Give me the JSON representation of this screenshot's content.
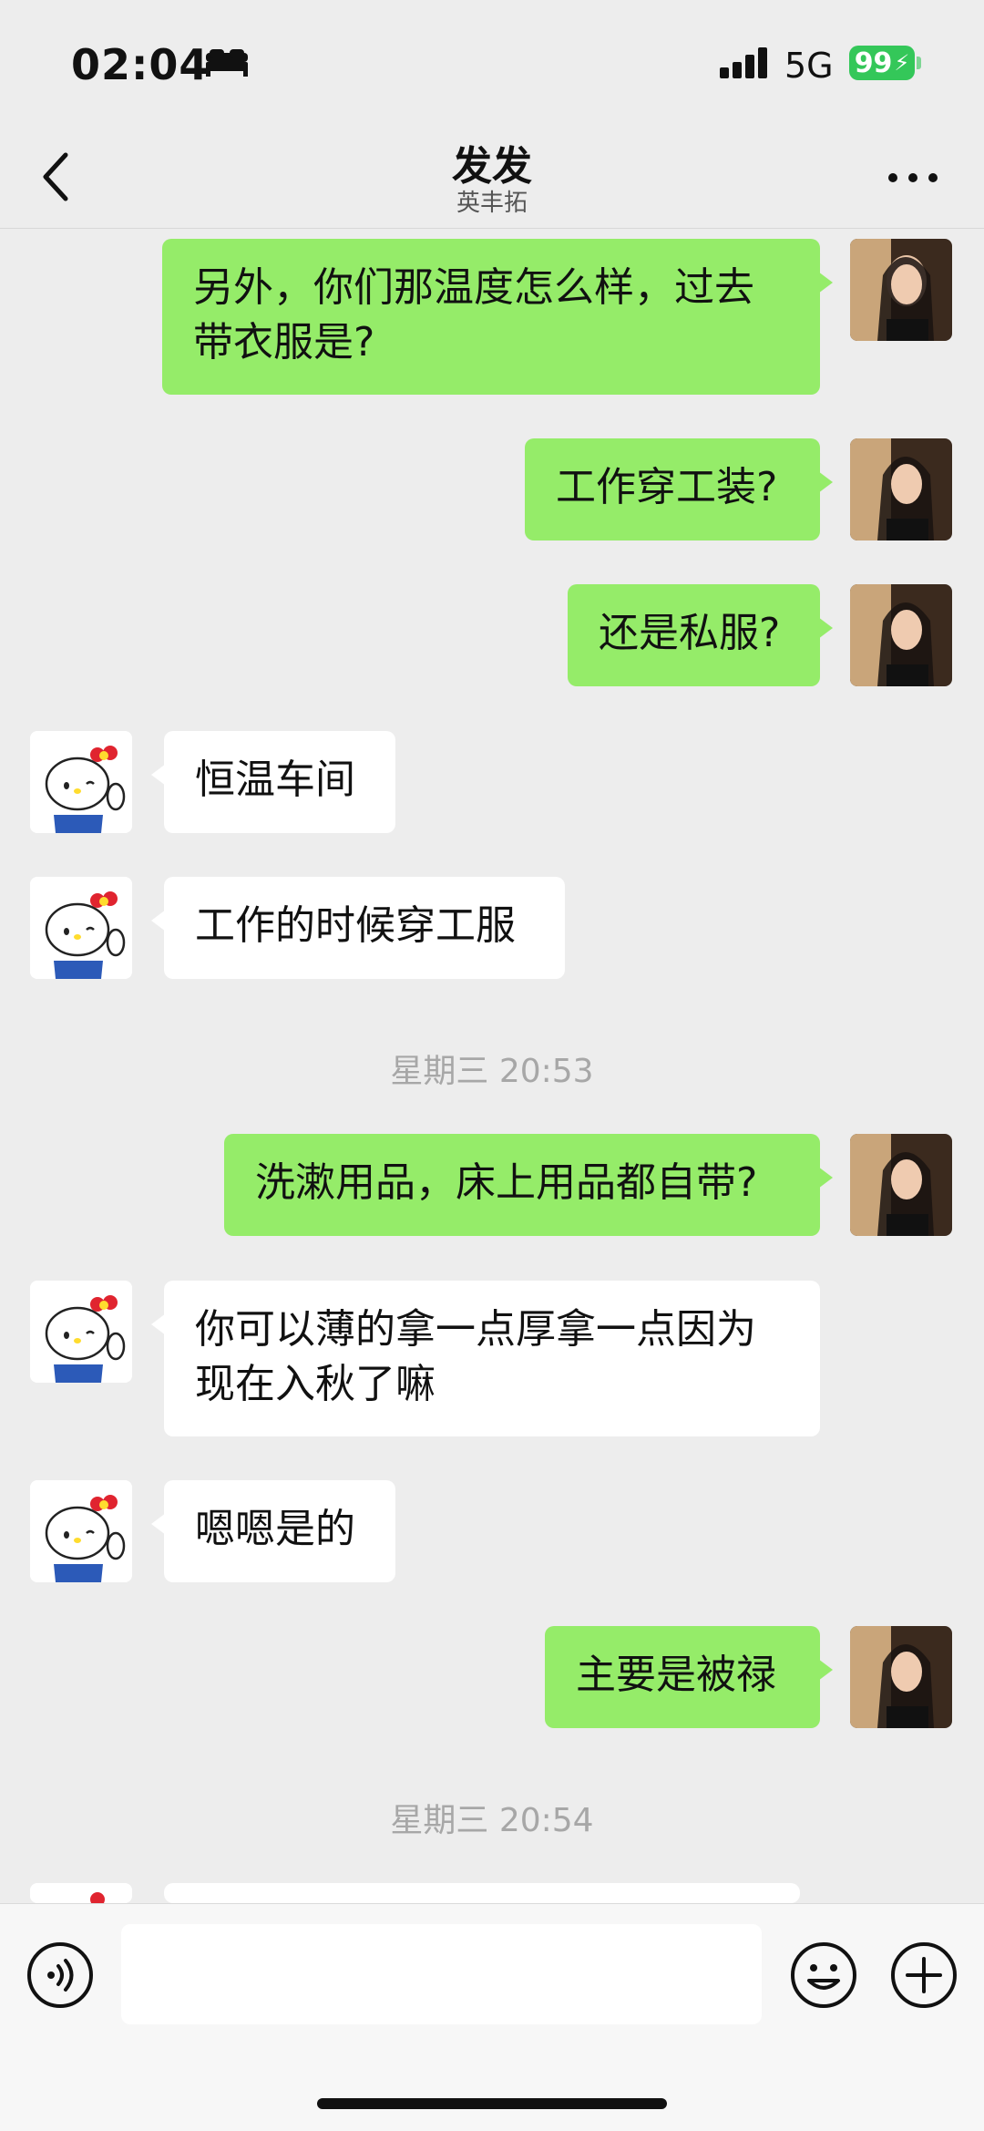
{
  "status_bar": {
    "time": "02:04",
    "network": "5G",
    "battery": "99"
  },
  "nav": {
    "title": "发发",
    "subtitle": "英丰拓"
  },
  "messages": [
    {
      "sender": "me",
      "text": "另外，你们那温度怎么样，过去\n带衣服是?"
    },
    {
      "sender": "me",
      "text": "工作穿工装?"
    },
    {
      "sender": "me",
      "text": "还是私服?"
    },
    {
      "sender": "other",
      "text": "恒温车间"
    },
    {
      "sender": "other",
      "text": "工作的时候穿工服"
    },
    {
      "sender": "timestamp",
      "text": "星期三 20:53"
    },
    {
      "sender": "me",
      "text": "洗漱用品，床上用品都自带?"
    },
    {
      "sender": "other",
      "text": "你可以薄的拿一点厚拿一点因为\n现在入秋了嘛"
    },
    {
      "sender": "other",
      "text": "嗯嗯是的"
    },
    {
      "sender": "me",
      "text": "主要是被禄"
    },
    {
      "sender": "timestamp",
      "text": "星期三 20:54"
    }
  ],
  "input": {
    "placeholder": ""
  },
  "colors": {
    "my_bubble": "#95EC69",
    "other_bubble": "#FFFFFF",
    "background": "#EDEDED",
    "battery": "#34C759"
  },
  "icons": [
    "bed-icon",
    "signal-icon",
    "back-icon",
    "more-icon",
    "voice-icon",
    "emoji-icon",
    "plus-icon"
  ]
}
